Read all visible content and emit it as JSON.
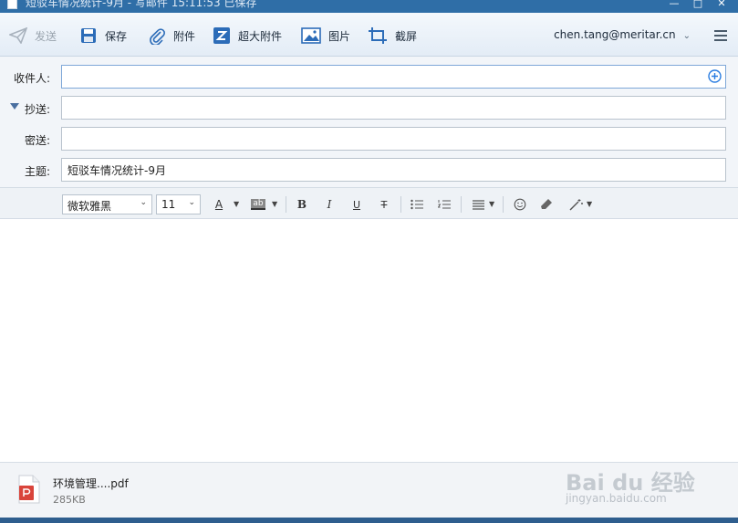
{
  "window": {
    "title": "短驳车情况统计-9月 - 写邮件    15:11:53 已保存",
    "minimize_glyph": "—",
    "maximize_glyph": "□",
    "close_glyph": "✕"
  },
  "toolbar": {
    "send_label": "发送",
    "save_label": "保存",
    "attach_label": "附件",
    "large_attach_label": "超大附件",
    "image_label": "图片",
    "screenshot_label": "截屏",
    "account": "chen.tang@meritar.cn",
    "icons": [
      "send-icon",
      "save-icon",
      "paperclip-icon",
      "large-attachment-icon",
      "image-icon",
      "screenshot-crop-icon",
      "hamburger-menu-icon"
    ]
  },
  "fields": {
    "to_label": "收件人:",
    "to_value": "",
    "cc_label": "抄送:",
    "cc_value": "",
    "bcc_label": "密送:",
    "bcc_value": "",
    "subject_label": "主题:",
    "subject_value": "短驳车情况统计-9月"
  },
  "format": {
    "font_family": "微软雅黑",
    "font_size": "11",
    "bold": "B",
    "italic": "I",
    "underline": "U",
    "strike": "T",
    "font_color_glyph": "A",
    "highlight_glyph": "ab"
  },
  "attachments": [
    {
      "name": "环境管理....pdf",
      "size": "285KB",
      "type": "pdf"
    }
  ],
  "watermark": {
    "logo": "Bai du 经验",
    "url": "jingyan.baidu.com"
  },
  "colors": {
    "titlebar": "#2f6ea7",
    "toolbar_bg": "#e3ecf6",
    "accent_blue": "#2a7de1",
    "pdf_red": "#d9443b"
  }
}
